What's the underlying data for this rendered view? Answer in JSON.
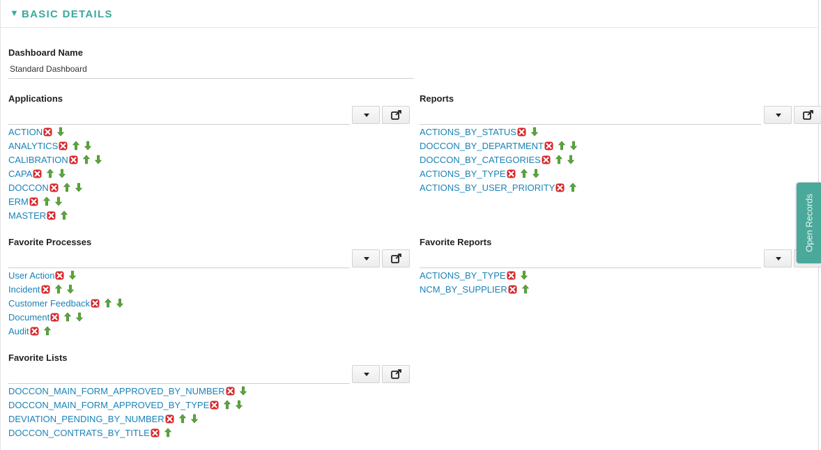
{
  "section": {
    "title": "BASIC DETAILS",
    "collapse_icon": "triangle-down-icon"
  },
  "dashboard_name": {
    "label": "Dashboard Name",
    "value": "Standard Dashboard"
  },
  "applications": {
    "label": "Applications",
    "items": [
      {
        "label": "ACTION",
        "up": false,
        "down": true
      },
      {
        "label": "ANALYTICS",
        "up": true,
        "down": true
      },
      {
        "label": "CALIBRATION",
        "up": true,
        "down": true
      },
      {
        "label": "CAPA",
        "up": true,
        "down": true
      },
      {
        "label": "DOCCON",
        "up": true,
        "down": true
      },
      {
        "label": "ERM",
        "up": true,
        "down": true
      },
      {
        "label": "MASTER",
        "up": true,
        "down": false
      }
    ]
  },
  "reports": {
    "label": "Reports",
    "items": [
      {
        "label": "ACTIONS_BY_STATUS",
        "up": false,
        "down": true
      },
      {
        "label": "DOCCON_BY_DEPARTMENT",
        "up": true,
        "down": true
      },
      {
        "label": "DOCCON_BY_CATEGORIES",
        "up": true,
        "down": true
      },
      {
        "label": "ACTIONS_BY_TYPE",
        "up": true,
        "down": true
      },
      {
        "label": "ACTIONS_BY_USER_PRIORITY",
        "up": true,
        "down": false
      }
    ]
  },
  "favorite_processes": {
    "label": "Favorite Processes",
    "items": [
      {
        "label": "User Action",
        "up": false,
        "down": true
      },
      {
        "label": "Incident",
        "up": true,
        "down": true
      },
      {
        "label": "Customer Feedback",
        "up": true,
        "down": true
      },
      {
        "label": "Document",
        "up": true,
        "down": true
      },
      {
        "label": "Audit",
        "up": true,
        "down": false
      }
    ]
  },
  "favorite_reports": {
    "label": "Favorite Reports",
    "items": [
      {
        "label": "ACTIONS_BY_TYPE",
        "up": false,
        "down": true
      },
      {
        "label": "NCM_BY_SUPPLIER",
        "up": true,
        "down": false
      }
    ]
  },
  "favorite_lists": {
    "label": "Favorite Lists",
    "items": [
      {
        "label": "DOCCON_MAIN_FORM_APPROVED_BY_NUMBER",
        "up": false,
        "down": true
      },
      {
        "label": "DOCCON_MAIN_FORM_APPROVED_BY_TYPE",
        "up": true,
        "down": true
      },
      {
        "label": "DEVIATION_PENDING_BY_NUMBER",
        "up": true,
        "down": true
      },
      {
        "label": "DOCCON_CONTRATS_BY_TITLE",
        "up": true,
        "down": false
      }
    ]
  },
  "side_tab": {
    "label": "Open Records"
  },
  "icons": {
    "remove": "remove-x-icon",
    "up": "move-up-arrow-icon",
    "down": "move-down-arrow-icon",
    "dropdown": "caret-down-icon",
    "open": "external-link-icon"
  },
  "colors": {
    "accent": "#3aa99b",
    "link": "#1a82b8",
    "remove": "#d9262b",
    "arrow": "#5aa83a",
    "side_tab": "#4aa99a"
  }
}
